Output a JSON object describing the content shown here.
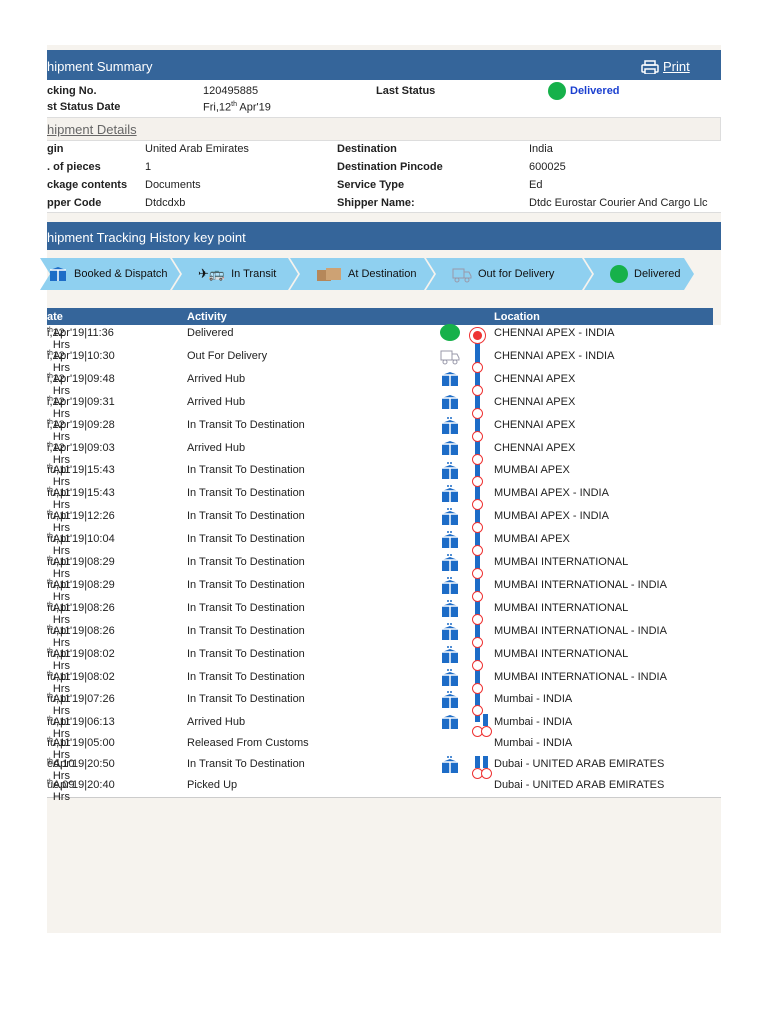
{
  "summary": {
    "title": "hipment Summary",
    "print": "Print",
    "tracking_label": "cking No.",
    "tracking_value": "120495885",
    "last_status_label": "Last Status",
    "last_status_value": "Delivered",
    "status_date_label": "st Status Date",
    "status_date": {
      "pre": "Fri,12",
      "sup": "th",
      "post": " Apr'19"
    }
  },
  "details": {
    "title": "hipment Details",
    "left": [
      {
        "label": "gin",
        "value": "United Arab Emirates"
      },
      {
        "label": ". of pieces",
        "value": "1"
      },
      {
        "label": "ckage contents",
        "value": "Documents"
      },
      {
        "label": "pper Code",
        "value": "Dtdcdxb"
      }
    ],
    "right": [
      {
        "label": "Destination",
        "value": "India"
      },
      {
        "label": "Destination Pincode",
        "value": "600025"
      },
      {
        "label": "Service Type",
        "value": "Ed"
      },
      {
        "label": "Shipper Name:",
        "value": "Dtdc Eurostar Courier And Cargo Llc"
      }
    ]
  },
  "history": {
    "title": "hipment Tracking History key point",
    "steps": [
      {
        "label": "Booked & Dispatch",
        "icon": "box-icon"
      },
      {
        "label": "In Transit",
        "icon": "plane-bus-icon"
      },
      {
        "label": "At Destination",
        "icon": "cartons-icon"
      },
      {
        "label": "Out for Delivery",
        "icon": "delivery-truck-icon"
      },
      {
        "label": "Delivered",
        "icon": "green-dot-icon"
      }
    ]
  },
  "colors": {
    "header": "#35659a",
    "step": "#8fd0f0",
    "delivered": "#16b14a",
    "timeline": "#1d6cc7",
    "link": "#1a3fd0"
  },
  "table": {
    "headers": {
      "date": "ate",
      "activity": "Activity",
      "location": "Location"
    },
    "rows": [
      {
        "d": "i,12",
        "s": "th",
        "t": " Apr'19|11:36 Hrs",
        "a": "Delivered",
        "l": "CHENNAI APEX - INDIA",
        "icon": "green"
      },
      {
        "d": "i,12",
        "s": "th",
        "t": " Apr'19|10:30 Hrs",
        "a": "Out For Delivery",
        "l": "CHENNAI APEX - INDIA",
        "icon": "truck"
      },
      {
        "d": "i,12",
        "s": "th",
        "t": " Apr'19|09:48 Hrs",
        "a": "Arrived Hub",
        "l": "CHENNAI APEX",
        "icon": "box"
      },
      {
        "d": "i,12",
        "s": "th",
        "t": " Apr'19|09:31 Hrs",
        "a": "Arrived Hub",
        "l": "CHENNAI APEX",
        "icon": "box"
      },
      {
        "d": "i,12",
        "s": "th",
        "t": " Apr'19|09:28 Hrs",
        "a": "In Transit To Destination",
        "l": "CHENNAI APEX",
        "icon": "transit"
      },
      {
        "d": "i,12",
        "s": "th",
        "t": " Apr'19|09:03 Hrs",
        "a": "Arrived Hub",
        "l": "CHENNAI APEX",
        "icon": "box"
      },
      {
        "d": "ıu,11",
        "s": "th",
        "t": " Apr'19|15:43 Hrs",
        "a": "In Transit To Destination",
        "l": "MUMBAI APEX",
        "icon": "transit"
      },
      {
        "d": "ıu,11",
        "s": "th",
        "t": " Apr'19|15:43 Hrs",
        "a": "In Transit To Destination",
        "l": "MUMBAI APEX - INDIA",
        "icon": "transit"
      },
      {
        "d": "ıu,11",
        "s": "th",
        "t": " Apr'19|12:26 Hrs",
        "a": "In Transit To Destination",
        "l": "MUMBAI APEX - INDIA",
        "icon": "transit"
      },
      {
        "d": "ıu,11",
        "s": "th",
        "t": " Apr'19|10:04 Hrs",
        "a": "In Transit To Destination",
        "l": "MUMBAI APEX",
        "icon": "transit"
      },
      {
        "d": "ıu,11",
        "s": "th",
        "t": " Apr'19|08:29 Hrs",
        "a": "In Transit To Destination",
        "l": "MUMBAI INTERNATIONAL",
        "icon": "transit"
      },
      {
        "d": "ıu,11",
        "s": "th",
        "t": " Apr'19|08:29 Hrs",
        "a": "In Transit To Destination",
        "l": "MUMBAI INTERNATIONAL - INDIA",
        "icon": "transit"
      },
      {
        "d": "ıu,11",
        "s": "th",
        "t": " Apr'19|08:26 Hrs",
        "a": "In Transit To Destination",
        "l": "MUMBAI INTERNATIONAL",
        "icon": "transit"
      },
      {
        "d": "ıu,11",
        "s": "th",
        "t": " Apr'19|08:26 Hrs",
        "a": "In Transit To Destination",
        "l": "MUMBAI INTERNATIONAL - INDIA",
        "icon": "transit"
      },
      {
        "d": "ıu,11",
        "s": "th",
        "t": " Apr'19|08:02 Hrs",
        "a": "In Transit To Destination",
        "l": "MUMBAI INTERNATIONAL",
        "icon": "transit"
      },
      {
        "d": "ıu,11",
        "s": "th",
        "t": " Apr'19|08:02 Hrs",
        "a": "In Transit To Destination",
        "l": "MUMBAI INTERNATIONAL - INDIA",
        "icon": "transit"
      },
      {
        "d": "ıu,11",
        "s": "th",
        "t": " Apr'19|07:26 Hrs",
        "a": "In Transit To Destination",
        "l": "Mumbai - INDIA",
        "icon": "transit"
      },
      {
        "d": "ıu,11",
        "s": "th",
        "t": " Apr'19|06:13 Hrs",
        "a": "Arrived Hub",
        "l": "Mumbai - INDIA",
        "icon": "box"
      },
      {
        "d": "ıu,11",
        "s": "th",
        "t": " Apr'19|05:00 Hrs",
        "a": "Released From Customs",
        "l": "Mumbai - INDIA",
        "icon": ""
      },
      {
        "d": "ed,10",
        "s": "th",
        "t": " Apr'19|20:50 Hrs",
        "a": "In Transit To Destination",
        "l": "Dubai - UNITED ARAB EMIRATES",
        "icon": "transit"
      },
      {
        "d": "ue,09",
        "s": "th",
        "t": " Apr'19|20:40 Hrs",
        "a": "Picked Up",
        "l": "Dubai - UNITED ARAB EMIRATES",
        "icon": ""
      }
    ]
  }
}
